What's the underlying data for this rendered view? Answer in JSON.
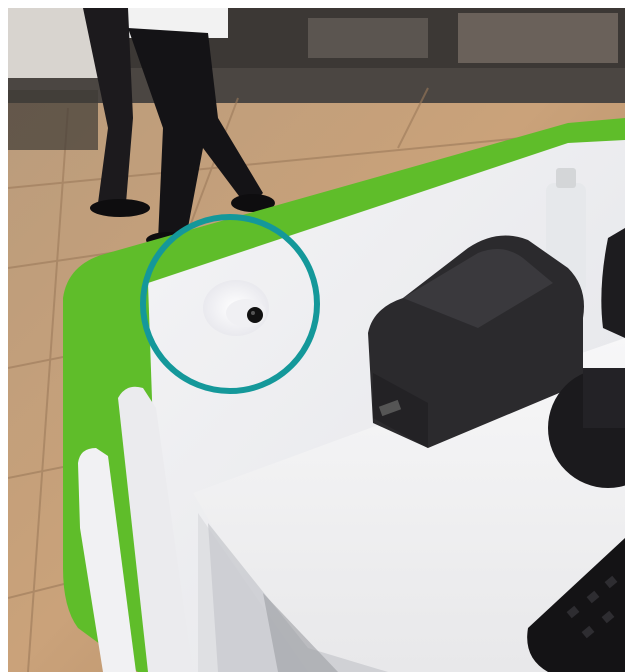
{
  "photo": {
    "subject": "kiosk-counter-with-hidden-camera",
    "palette": {
      "floor": "#c9a47c",
      "floor_dark": "#8a6a4c",
      "counter_trim": "#66c22d",
      "counter_panel": "#f3f3f5",
      "printer": "#2a2a2c",
      "highlight_ring": "#14989a"
    },
    "highlight": {
      "marker": "circle-marker",
      "target": "camera"
    }
  }
}
